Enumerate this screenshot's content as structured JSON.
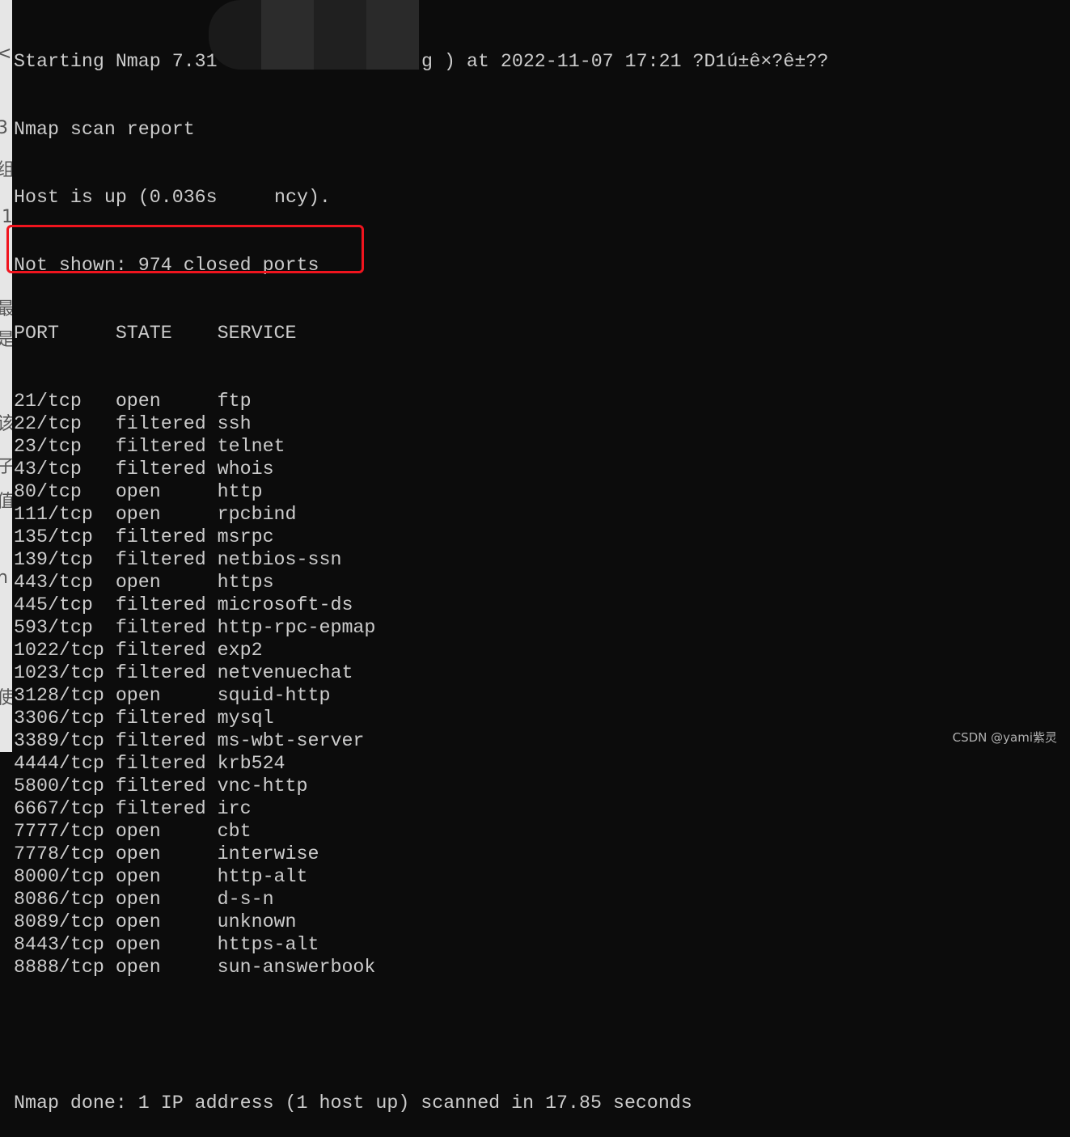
{
  "header": {
    "line1_start": "Starting Nmap 7.31",
    "line1_end": "g ) at 2022-11-07 17:21 ?D1ú±ê×?ê±??",
    "line2": "Nmap scan report",
    "line3_start": "Host is up (0.036s",
    "line3_end": "ncy).",
    "line4": "Not shown: 974 closed ports"
  },
  "columns": [
    "PORT",
    "STATE",
    "SERVICE"
  ],
  "ports": [
    [
      "21/tcp",
      "open",
      "ftp"
    ],
    [
      "22/tcp",
      "filtered",
      "ssh"
    ],
    [
      "23/tcp",
      "filtered",
      "telnet"
    ],
    [
      "43/tcp",
      "filtered",
      "whois"
    ],
    [
      "80/tcp",
      "open",
      "http"
    ],
    [
      "111/tcp",
      "open",
      "rpcbind"
    ],
    [
      "135/tcp",
      "filtered",
      "msrpc"
    ],
    [
      "139/tcp",
      "filtered",
      "netbios-ssn"
    ],
    [
      "443/tcp",
      "open",
      "https"
    ],
    [
      "445/tcp",
      "filtered",
      "microsoft-ds"
    ],
    [
      "593/tcp",
      "filtered",
      "http-rpc-epmap"
    ],
    [
      "1022/tcp",
      "filtered",
      "exp2"
    ],
    [
      "1023/tcp",
      "filtered",
      "netvenuechat"
    ],
    [
      "3128/tcp",
      "open",
      "squid-http"
    ],
    [
      "3306/tcp",
      "filtered",
      "mysql"
    ],
    [
      "3389/tcp",
      "filtered",
      "ms-wbt-server"
    ],
    [
      "4444/tcp",
      "filtered",
      "krb524"
    ],
    [
      "5800/tcp",
      "filtered",
      "vnc-http"
    ],
    [
      "6667/tcp",
      "filtered",
      "irc"
    ],
    [
      "7777/tcp",
      "open",
      "cbt"
    ],
    [
      "7778/tcp",
      "open",
      "interwise"
    ],
    [
      "8000/tcp",
      "open",
      "http-alt"
    ],
    [
      "8086/tcp",
      "open",
      "d-s-n"
    ],
    [
      "8089/tcp",
      "open",
      "unknown"
    ],
    [
      "8443/tcp",
      "open",
      "https-alt"
    ],
    [
      "8888/tcp",
      "open",
      "sun-answerbook"
    ]
  ],
  "footer": "Nmap done: 1 IP address (1 host up) scanned in 17.85 seconds",
  "highlight_color": "#f0141e",
  "watermark": "CSDN @yami紫灵",
  "left_strip": [
    "<",
    "3",
    "组",
    "1",
    "最",
    "是",
    "该",
    "子",
    "值",
    "n",
    "使"
  ]
}
